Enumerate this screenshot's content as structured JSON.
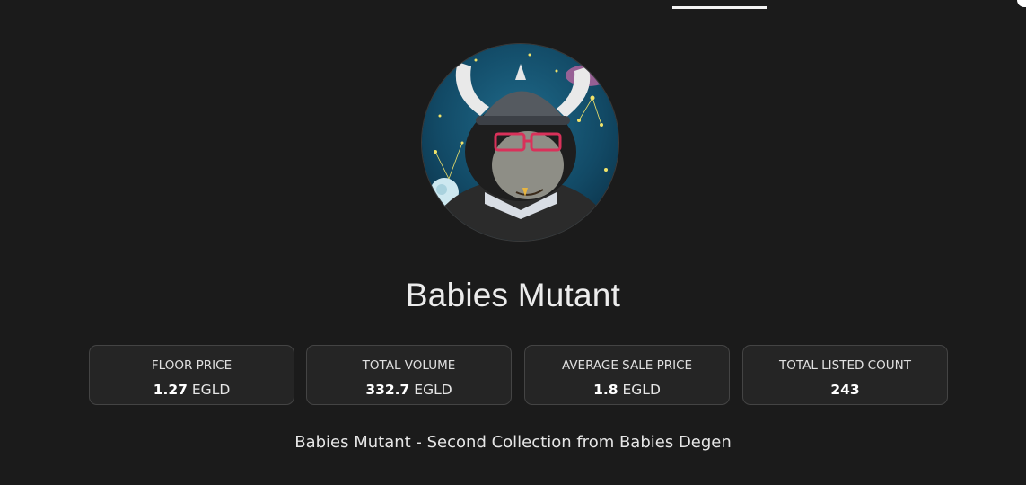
{
  "collection": {
    "name": "Babies Mutant",
    "description": "Babies Mutant - Second Collection from Babies Degen",
    "avatar_icon": "mutant-ape-viking-helmet-avatar"
  },
  "stats": [
    {
      "label": "FLOOR PRICE",
      "value": "1.27",
      "unit": "EGLD"
    },
    {
      "label": "TOTAL VOLUME",
      "value": "332.7",
      "unit": "EGLD"
    },
    {
      "label": "AVERAGE SALE PRICE",
      "value": "1.8",
      "unit": "EGLD"
    },
    {
      "label": "TOTAL LISTED COUNT",
      "value": "243",
      "unit": ""
    }
  ],
  "colors": {
    "background": "#1b1b1b",
    "card": "#252525",
    "card_border": "#444444",
    "text": "#e6e6e6"
  }
}
